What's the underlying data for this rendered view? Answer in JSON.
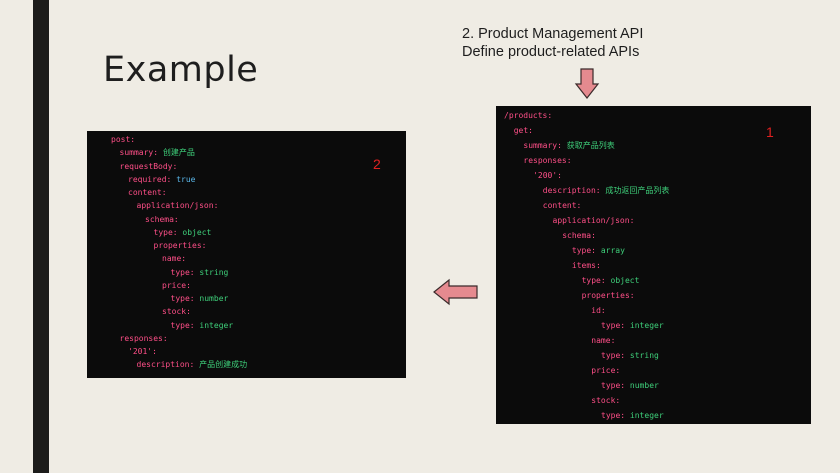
{
  "slide": {
    "title": "Example",
    "note_line1": "2. Product Management API",
    "note_line2": "Define product-related APIs"
  },
  "colors": {
    "background": "#efece4",
    "code_background": "#0b0b0b",
    "key": "#ff4f88",
    "value": "#3ecf7a",
    "boolean": "#5ab6e8",
    "badge": "#e02020",
    "arrow_fill": "#e58a8f",
    "arrow_stroke": "#3a2a2a"
  },
  "panel_left": {
    "badge": "2",
    "lines": [
      {
        "depth": 0,
        "key": "post:"
      },
      {
        "depth": 1,
        "key": "summary:",
        "value": "创建产品"
      },
      {
        "depth": 1,
        "key": "requestBody:"
      },
      {
        "depth": 2,
        "key": "required:",
        "value": "true",
        "kind": "bool"
      },
      {
        "depth": 2,
        "key": "content:"
      },
      {
        "depth": 3,
        "key": "application/json:"
      },
      {
        "depth": 4,
        "key": "schema:"
      },
      {
        "depth": 5,
        "key": "type:",
        "value": "object"
      },
      {
        "depth": 5,
        "key": "properties:"
      },
      {
        "depth": 6,
        "key": "name:"
      },
      {
        "depth": 7,
        "key": "type:",
        "value": "string"
      },
      {
        "depth": 6,
        "key": "price:"
      },
      {
        "depth": 7,
        "key": "type:",
        "value": "number"
      },
      {
        "depth": 6,
        "key": "stock:"
      },
      {
        "depth": 7,
        "key": "type:",
        "value": "integer"
      },
      {
        "depth": 1,
        "key": "responses:"
      },
      {
        "depth": 2,
        "key": "'201':"
      },
      {
        "depth": 3,
        "key": "description:",
        "value": "产品创建成功"
      }
    ]
  },
  "panel_right": {
    "badge": "1",
    "lines": [
      {
        "depth": 0,
        "key": "/products:"
      },
      {
        "depth": 1,
        "key": "get:"
      },
      {
        "depth": 2,
        "key": "summary:",
        "value": "获取产品列表"
      },
      {
        "depth": 2,
        "key": "responses:"
      },
      {
        "depth": 3,
        "key": "'200':"
      },
      {
        "depth": 4,
        "key": "description:",
        "value": "成功返回产品列表"
      },
      {
        "depth": 4,
        "key": "content:"
      },
      {
        "depth": 5,
        "key": "application/json:"
      },
      {
        "depth": 6,
        "key": "schema:"
      },
      {
        "depth": 7,
        "key": "type:",
        "value": "array"
      },
      {
        "depth": 7,
        "key": "items:"
      },
      {
        "depth": 8,
        "key": "type:",
        "value": "object"
      },
      {
        "depth": 8,
        "key": "properties:"
      },
      {
        "depth": 9,
        "key": "id:"
      },
      {
        "depth": 10,
        "key": "type:",
        "value": "integer"
      },
      {
        "depth": 9,
        "key": "name:"
      },
      {
        "depth": 10,
        "key": "type:",
        "value": "string"
      },
      {
        "depth": 9,
        "key": "price:"
      },
      {
        "depth": 10,
        "key": "type:",
        "value": "number"
      },
      {
        "depth": 9,
        "key": "stock:"
      },
      {
        "depth": 10,
        "key": "type:",
        "value": "integer"
      }
    ]
  }
}
